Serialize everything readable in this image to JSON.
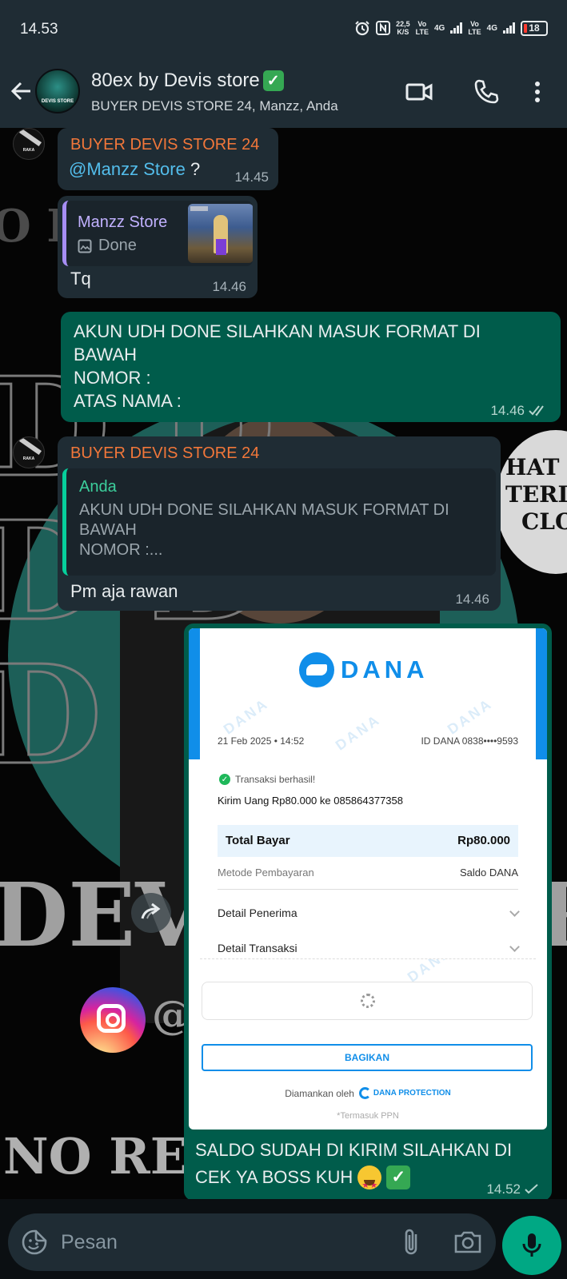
{
  "status_bar": {
    "time": "14.53",
    "net_speed_value": "22,5",
    "net_speed_unit": "K/S",
    "vo1_top": "Vo",
    "vo1_bottom": "LTE",
    "net1": "4G",
    "vo2_top": "Vo",
    "vo2_bottom": "LTE",
    "net2": "4G",
    "battery": "18"
  },
  "header": {
    "title": "80ex by Devis store",
    "subtitle": "BUYER DEVIS STORE 24, Manzz, Anda",
    "avatar_text": "DEVIS STORE"
  },
  "messages": {
    "m1": {
      "sender": "BUYER DEVIS STORE 24",
      "mention": "@Manzz Store",
      "text": " ?",
      "time": "14.45"
    },
    "m2": {
      "quote_name": "Manzz Store",
      "quote_text": "Done",
      "text": "Tq",
      "time": "14.46"
    },
    "m3": {
      "lines": [
        "AKUN UDH DONE SILAHKAN MASUK FORMAT DI",
        "BAWAH",
        "NOMOR :",
        "ATAS NAMA :"
      ],
      "time": "14.46"
    },
    "m4": {
      "sender": "BUYER DEVIS STORE 24",
      "quote_name": "Anda",
      "quote_lines": [
        "AKUN UDH DONE SILAHKAN MASUK FORMAT DI",
        "BAWAH",
        "NOMOR :..."
      ],
      "text": "Pm  aja rawan",
      "time": "14.46"
    },
    "m5": {
      "lines": [
        "SALDO SUDAH DI KIRIM SILAHKAN DI",
        "CEK YA BOSS KUH"
      ],
      "time": "14.52"
    }
  },
  "receipt": {
    "brand": "DANA",
    "date": "21 Feb 2025 • 14:52",
    "id": "ID DANA 0838••••9593",
    "status": "Transaksi berhasil!",
    "send_text": "Kirim Uang Rp80.000 ke 085864377358",
    "total_label": "Total Bayar",
    "total_value": "Rp80.000",
    "method_label": "Metode Pembayaran",
    "method_value": "Saldo DANA",
    "recipient_label": "Detail Penerima",
    "transaction_label": "Detail Transaksi",
    "share_label": "BAGIKAN",
    "secured_by": "Diamankan oleh",
    "protection": "DANA PROTECTION",
    "tax_note": "*Termasuk PPN"
  },
  "wallpaper": {
    "badge_lines": [
      "HAT",
      "TERI",
      "CLO"
    ],
    "bottom_text": "NO REA",
    "insta_at": "@",
    "devis_left": "DEV",
    "devis_right": "R"
  },
  "input": {
    "placeholder": "Pesan"
  },
  "colors": {
    "header_bg": "#1f2c34",
    "incoming": "#1f2c34",
    "outgoing": "#005c4b",
    "accent": "#00a884",
    "dana_blue": "#108ee9"
  }
}
